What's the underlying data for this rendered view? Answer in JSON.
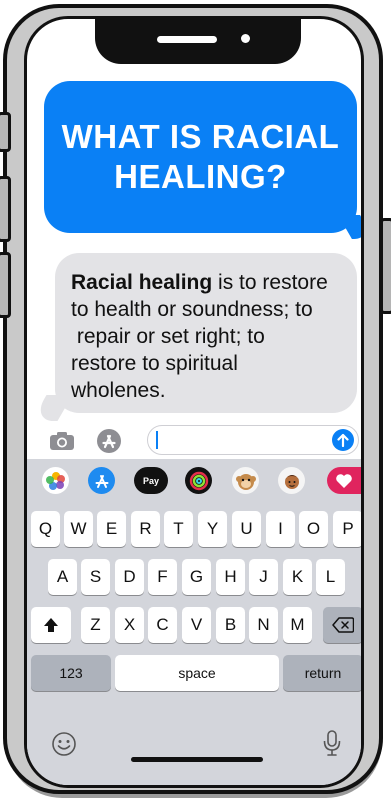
{
  "messages": {
    "sent": {
      "line1": "WHAT IS RACIAL",
      "line2": "HEALING?"
    },
    "received": {
      "bold": "Racial healing",
      "line1": " is to restore",
      "line2": "to health or soundness; to",
      "line3": " repair or set right; to",
      "line4": "restore to spiritual",
      "line5": "wholenes."
    }
  },
  "input": {
    "value": ""
  },
  "apps": [
    {
      "name": "photos"
    },
    {
      "name": "app-store"
    },
    {
      "name": "apple-pay",
      "label": "Pay"
    },
    {
      "name": "activity"
    },
    {
      "name": "animoji"
    },
    {
      "name": "memoji"
    },
    {
      "name": "hearts"
    }
  ],
  "keyboard": {
    "row1": [
      "Q",
      "W",
      "E",
      "R",
      "T",
      "Y",
      "U",
      "I",
      "O",
      "P"
    ],
    "row2": [
      "A",
      "S",
      "D",
      "F",
      "G",
      "H",
      "J",
      "K",
      "L"
    ],
    "row3": [
      "Z",
      "X",
      "C",
      "V",
      "B",
      "N",
      "M"
    ],
    "numbers_label": "123",
    "space_label": "space",
    "return_label": "return"
  },
  "colors": {
    "accent": "#0a80f5",
    "bubble_gray": "#e3e3e6",
    "keyboard_bg": "#d3d5db"
  }
}
